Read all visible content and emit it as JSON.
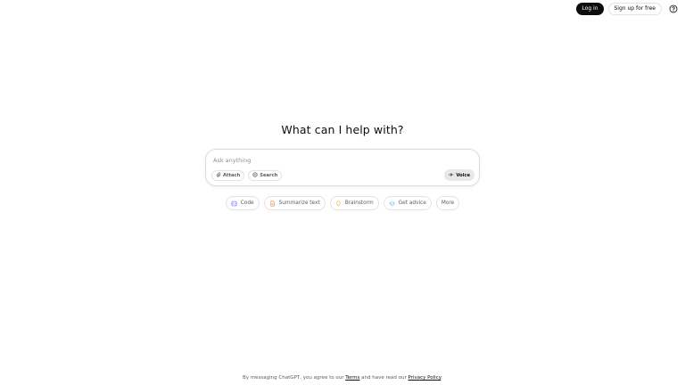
{
  "header": {
    "login_label": "Log in",
    "signup_label": "Sign up for free",
    "help_icon": "question-circle-icon"
  },
  "main": {
    "heading": "What can I help with?"
  },
  "composer": {
    "placeholder": "Ask anything",
    "value": "",
    "attach_label": "Attach",
    "search_label": "Search",
    "voice_label": "Voice"
  },
  "suggestions": [
    {
      "label": "Code",
      "icon": "code-icon",
      "color": "#6c71ff"
    },
    {
      "label": "Summarize text",
      "icon": "document-icon",
      "color": "#ea8444"
    },
    {
      "label": "Brainstorm",
      "icon": "lightbulb-icon",
      "color": "#e2c541"
    },
    {
      "label": "Get advice",
      "icon": "graduation-cap-icon",
      "color": "#76d0eb"
    },
    {
      "label": "More",
      "icon": "",
      "color": ""
    }
  ],
  "footer": {
    "prefix": "By messaging ChatGPT, you agree to our",
    "terms_label": "Terms",
    "middle": "and have read our",
    "privacy_label": "Privacy Policy",
    "suffix": "."
  }
}
